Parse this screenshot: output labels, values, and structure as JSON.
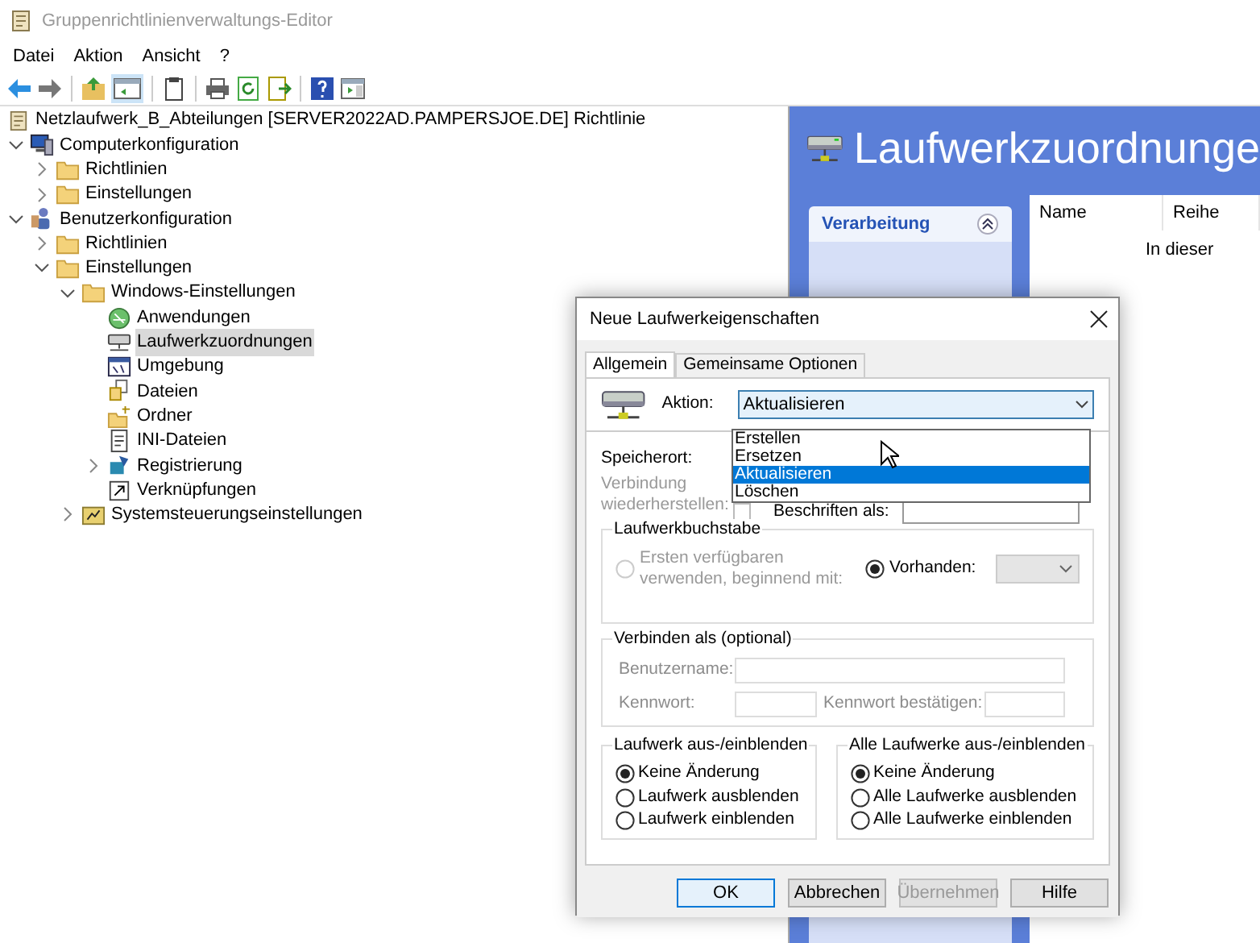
{
  "window": {
    "title": "Gruppenrichtlinienverwaltungs-Editor"
  },
  "menu": [
    "Datei",
    "Aktion",
    "Ansicht",
    "?"
  ],
  "tree": {
    "root": "Netzlaufwerk_B_Abteilungen [SERVER2022AD.PAMPERSJOE.DE] Richtlinie",
    "items": [
      {
        "label": "Computerkonfiguration",
        "kind": "computer",
        "expanded": true,
        "selected": false,
        "children": [
          {
            "label": "Richtlinien",
            "kind": "folder",
            "expanded": false,
            "selected": false
          },
          {
            "label": "Einstellungen",
            "kind": "folder",
            "expanded": false,
            "selected": false
          }
        ]
      },
      {
        "label": "Benutzerkonfiguration",
        "kind": "user",
        "expanded": true,
        "selected": false,
        "children": [
          {
            "label": "Richtlinien",
            "kind": "folder",
            "expanded": false,
            "selected": false
          },
          {
            "label": "Einstellungen",
            "kind": "folder",
            "expanded": true,
            "selected": false,
            "children": [
              {
                "label": "Windows-Einstellungen",
                "kind": "folder",
                "expanded": true,
                "selected": false,
                "children": [
                  {
                    "label": "Anwendungen",
                    "kind": "apps",
                    "selected": false
                  },
                  {
                    "label": "Laufwerkzuordnungen",
                    "kind": "drive",
                    "selected": true
                  },
                  {
                    "label": "Umgebung",
                    "kind": "env",
                    "selected": false
                  },
                  {
                    "label": "Dateien",
                    "kind": "files",
                    "selected": false
                  },
                  {
                    "label": "Ordner",
                    "kind": "newfolder",
                    "selected": false
                  },
                  {
                    "label": "INI-Dateien",
                    "kind": "ini",
                    "selected": false
                  },
                  {
                    "label": "Registrierung",
                    "kind": "registry",
                    "expanded": false,
                    "selected": false
                  },
                  {
                    "label": "Verknüpfungen",
                    "kind": "shortcut",
                    "selected": false
                  }
                ]
              },
              {
                "label": "Systemsteuerungseinstellungen",
                "kind": "control",
                "expanded": false,
                "selected": false
              }
            ]
          }
        ]
      }
    ]
  },
  "details": {
    "title": "Laufwerkzuordnunge",
    "task_box": "Verarbeitung",
    "columns": [
      "Name",
      "Reihe"
    ],
    "empty_message": "In dieser"
  },
  "dialog": {
    "title": "Neue Laufwerkeigenschaften",
    "tabs": [
      {
        "label": "Allgemein",
        "selected": true
      },
      {
        "label": "Gemeinsame Optionen",
        "selected": false
      }
    ],
    "action": {
      "label": "Aktion:",
      "value": "Aktualisieren",
      "open": true,
      "options": [
        {
          "label": "Erstellen",
          "selected": false
        },
        {
          "label": "Ersetzen",
          "selected": false
        },
        {
          "label": "Aktualisieren",
          "selected": true
        },
        {
          "label": "Löschen",
          "selected": false
        }
      ]
    },
    "location_label": "Speicherort:",
    "reconnect": {
      "label": "Verbindung wiederherstellen:",
      "checked": false,
      "disabled": true
    },
    "label_as": "Beschriften als:",
    "drive_letter": {
      "title": "Laufwerkbuchstabe",
      "options": [
        {
          "label": "Ersten verfügbaren verwenden, beginnend mit:",
          "selected": false,
          "disabled": true
        },
        {
          "label": "Vorhanden:",
          "selected": true,
          "disabled": false
        }
      ]
    },
    "connect_as": {
      "title": "Verbinden als (optional)",
      "disabled": true,
      "fields": [
        {
          "label": "Benutzername:"
        },
        {
          "label": "Kennwort:"
        },
        {
          "label": "Kennwort bestätigen:"
        }
      ]
    },
    "groups": [
      {
        "title": "Laufwerk aus-/einblenden",
        "options": [
          {
            "label": "Keine Änderung",
            "selected": true
          },
          {
            "label": "Laufwerk ausblenden",
            "selected": false
          },
          {
            "label": "Laufwerk einblenden",
            "selected": false
          }
        ]
      },
      {
        "title": "Alle Laufwerke aus-/einblenden",
        "options": [
          {
            "label": "Keine Änderung",
            "selected": true
          },
          {
            "label": "Alle Laufwerke ausblenden",
            "selected": false
          },
          {
            "label": "Alle Laufwerke einblenden",
            "selected": false
          }
        ]
      }
    ],
    "buttons": [
      {
        "label": "OK",
        "default": true,
        "disabled": false
      },
      {
        "label": "Abbrechen",
        "default": false,
        "disabled": false
      },
      {
        "label": "Übernehmen",
        "default": false,
        "disabled": true
      },
      {
        "label": "Hilfe",
        "default": false,
        "disabled": false
      }
    ]
  }
}
